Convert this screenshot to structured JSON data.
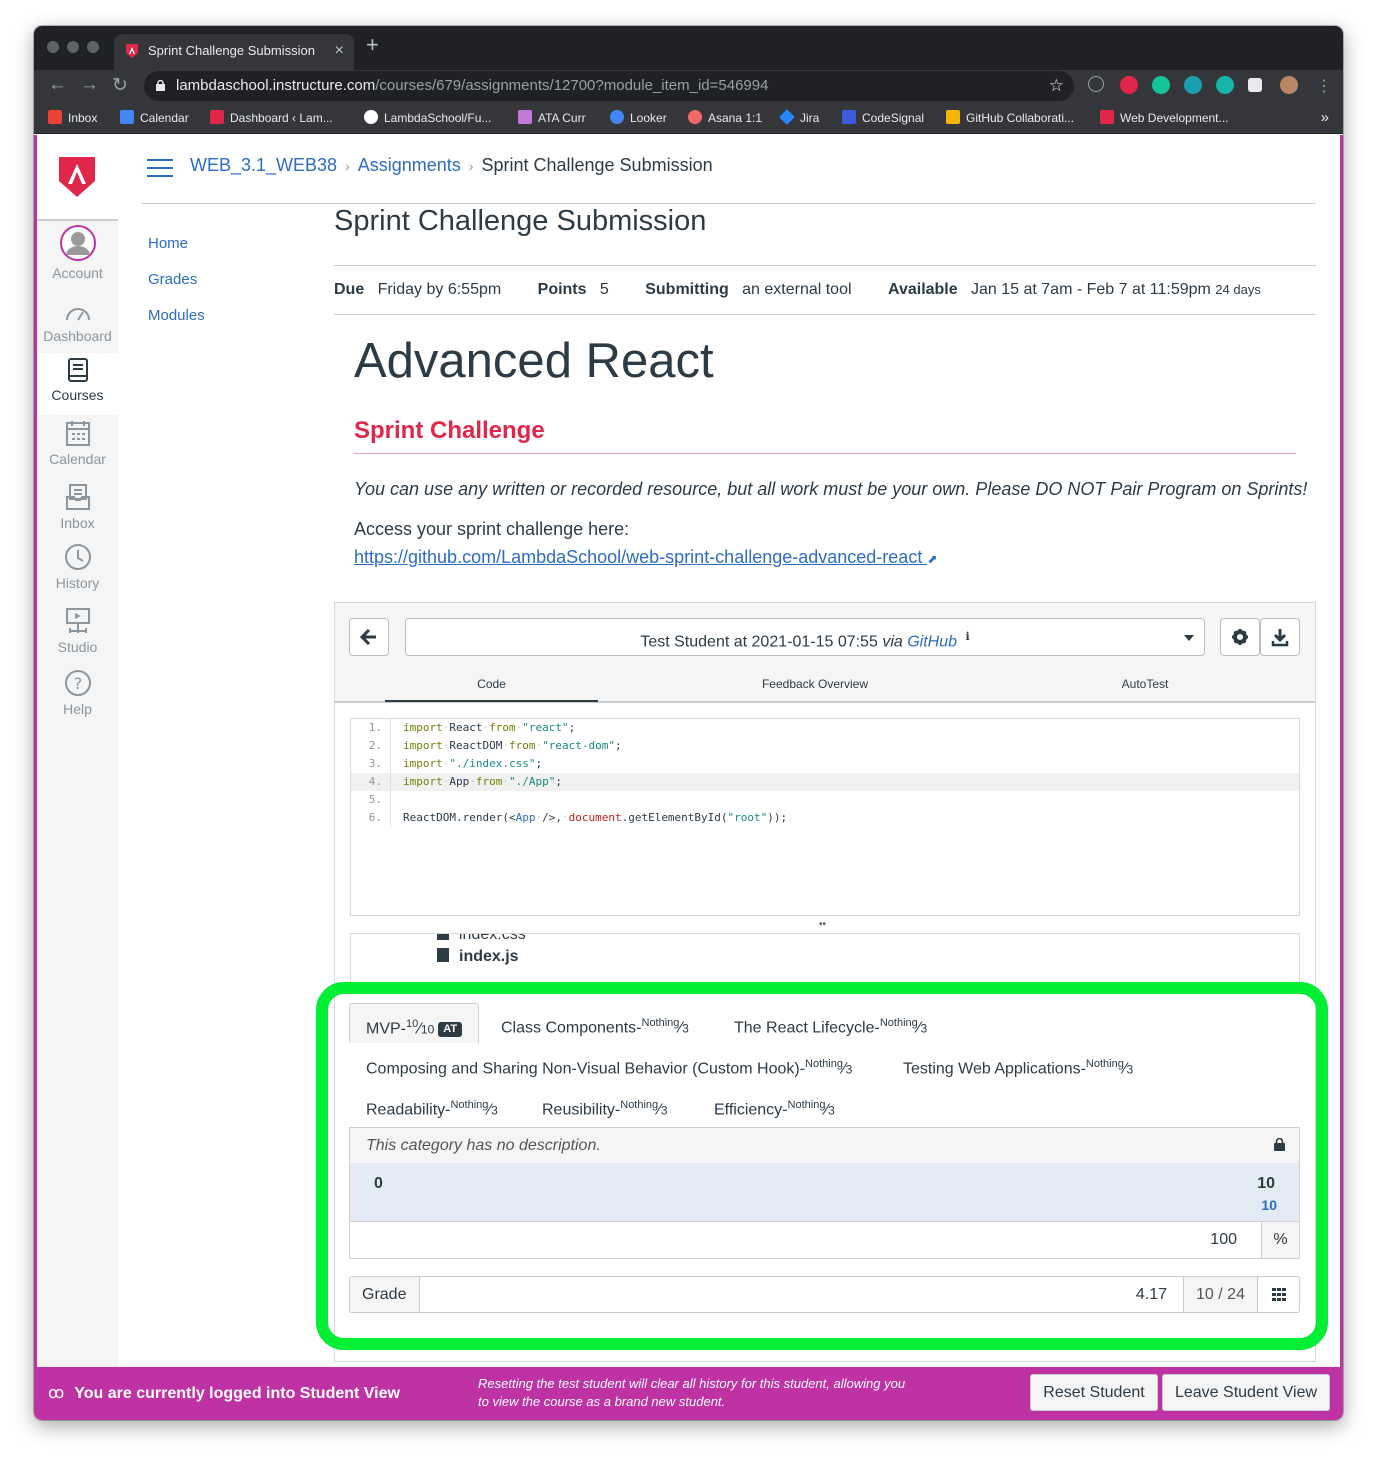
{
  "browser": {
    "tab_title": "Sprint Challenge Submission",
    "close_glyph": "×",
    "new_tab_glyph": "+",
    "url_host": "lambdaschool.instructure.com",
    "url_path": "/courses/679/assignments/12700?module_item_id=546994",
    "bookmarks": [
      {
        "label": "Inbox",
        "color": "#ea4335"
      },
      {
        "label": "Calendar",
        "color": "#4285f4"
      },
      {
        "label": "Dashboard ‹ Lam...",
        "color": "#e0274a"
      },
      {
        "label": "LambdaSchool/Fu...",
        "color": "#ffffff"
      },
      {
        "label": "ATA Curr",
        "color": "#bf7ad6"
      },
      {
        "label": "Looker",
        "color": "#4285f4"
      },
      {
        "label": "Asana 1:1",
        "color": "#f06a6a"
      },
      {
        "label": "Jira",
        "color": "#2684ff"
      },
      {
        "label": "CodeSignal",
        "color": "#3b5bdb"
      },
      {
        "label": "GitHub Collaborati...",
        "color": "#f4b400"
      },
      {
        "label": "Web Development...",
        "color": "#e0274a"
      }
    ],
    "more_glyph": "»"
  },
  "global_nav": {
    "items": [
      {
        "label": "Account",
        "icon": "avatar-icon"
      },
      {
        "label": "Dashboard",
        "icon": "dashboard-icon"
      },
      {
        "label": "Courses",
        "icon": "courses-icon"
      },
      {
        "label": "Calendar",
        "icon": "calendar-icon"
      },
      {
        "label": "Inbox",
        "icon": "inbox-icon"
      },
      {
        "label": "History",
        "icon": "history-icon"
      },
      {
        "label": "Studio",
        "icon": "studio-icon"
      },
      {
        "label": "Help",
        "icon": "help-icon"
      }
    ],
    "brand_color": "#e0274a"
  },
  "breadcrumb": {
    "course": "WEB_3.1_WEB38",
    "section": "Assignments",
    "current": "Sprint Challenge Submission",
    "separator": "›"
  },
  "course_nav": [
    "Home",
    "Grades",
    "Modules"
  ],
  "assignment": {
    "title": "Sprint Challenge Submission",
    "due_label": "Due",
    "due_value": "Friday by 6:55pm",
    "points_label": "Points",
    "points_value": "5",
    "submitting_label": "Submitting",
    "submitting_value": "an external tool",
    "available_label": "Available",
    "available_value": "Jan 15 at 7am - Feb 7 at 11:59pm",
    "available_days": "24 days"
  },
  "description": {
    "heading": "Advanced React",
    "subheading": "Sprint Challenge",
    "note": "You can use any written or recorded resource, but all work must be your own. Please DO NOT Pair Program on Sprints!",
    "access_text": "Access your sprint challenge here:",
    "link": "https://github.com/LambdaSchool/web-sprint-challenge-advanced-react",
    "link_ext_glyph": "⬈"
  },
  "tool": {
    "submission_prefix": "Test Student at 2021-01-15 07:55",
    "submission_via": "via",
    "submission_source": "GitHub",
    "info_glyph": "ℹ",
    "tabs": [
      "Code",
      "Feedback Overview",
      "AutoTest"
    ],
    "code_lines": [
      {
        "n": "1.",
        "parts": [
          [
            "kw",
            "import"
          ],
          [
            "dot",
            "·"
          ],
          [
            "",
            "React"
          ],
          [
            "dot",
            "·"
          ],
          [
            "kw",
            "from"
          ],
          [
            "dot",
            "·"
          ],
          [
            "st",
            "\"react\""
          ],
          [
            "",
            ";"
          ]
        ]
      },
      {
        "n": "2.",
        "parts": [
          [
            "kw",
            "import"
          ],
          [
            "dot",
            "·"
          ],
          [
            "",
            "ReactDOM"
          ],
          [
            "dot",
            "·"
          ],
          [
            "kw",
            "from"
          ],
          [
            "dot",
            "·"
          ],
          [
            "st",
            "\"react-dom\""
          ],
          [
            "",
            ";"
          ]
        ]
      },
      {
        "n": "3.",
        "parts": [
          [
            "kw",
            "import"
          ],
          [
            "dot",
            "·"
          ],
          [
            "st",
            "\"./index.css\""
          ],
          [
            "",
            ";"
          ]
        ]
      },
      {
        "n": "4.",
        "parts": [
          [
            "kw",
            "import"
          ],
          [
            "dot",
            "·"
          ],
          [
            "",
            "App"
          ],
          [
            "dot",
            "·"
          ],
          [
            "kw",
            "from"
          ],
          [
            "dot",
            "·"
          ],
          [
            "st",
            "\"./App\""
          ],
          [
            "",
            ";"
          ]
        ]
      },
      {
        "n": "5.",
        "parts": []
      },
      {
        "n": "6.",
        "parts": [
          [
            "",
            "ReactDOM.render(<"
          ],
          [
            "tg",
            "App"
          ],
          [
            "dot",
            "·"
          ],
          [
            "",
            "/>,"
          ],
          [
            "dot",
            "·"
          ],
          [
            "rd",
            "document"
          ],
          [
            "",
            ".getElementById("
          ],
          [
            "st",
            "\"root\""
          ],
          [
            "",
            "));"
          ]
        ]
      }
    ],
    "resizer_glyph": "••",
    "files": [
      "index.css",
      "index.js"
    ]
  },
  "rubric": {
    "categories": [
      {
        "name": "MVP-",
        "achieved": "10",
        "total": "10",
        "badge": "AT",
        "active": true
      },
      {
        "name": "Class Components-",
        "achieved": "Nothing",
        "total": "3"
      },
      {
        "name": "The React Lifecycle-",
        "achieved": "Nothing",
        "total": "3"
      },
      {
        "name": "Composing and Sharing Non-Visual Behavior (Custom Hook)-",
        "achieved": "Nothing",
        "total": "3"
      },
      {
        "name": "Testing Web Applications-",
        "achieved": "Nothing",
        "total": "3"
      },
      {
        "name": "Readability-",
        "achieved": "Nothing",
        "total": "3"
      },
      {
        "name": "Reusibility-",
        "achieved": "Nothing",
        "total": "3"
      },
      {
        "name": "Efficiency-",
        "achieved": "Nothing",
        "total": "3"
      }
    ],
    "category_description": "This category has no description.",
    "score_min": "0",
    "score_max": "10",
    "score_current": "10",
    "percent_value": "100",
    "percent_unit": "%",
    "grade_label": "Grade",
    "grade_value": "4.17",
    "grade_fraction": "10 / 24"
  },
  "student_view": {
    "message": "You are currently logged into Student View",
    "reset_note": "Resetting the test student will clear all history for this student, allowing you to view the course as a brand new student.",
    "reset_button": "Reset Student",
    "leave_button": "Leave Student View"
  }
}
